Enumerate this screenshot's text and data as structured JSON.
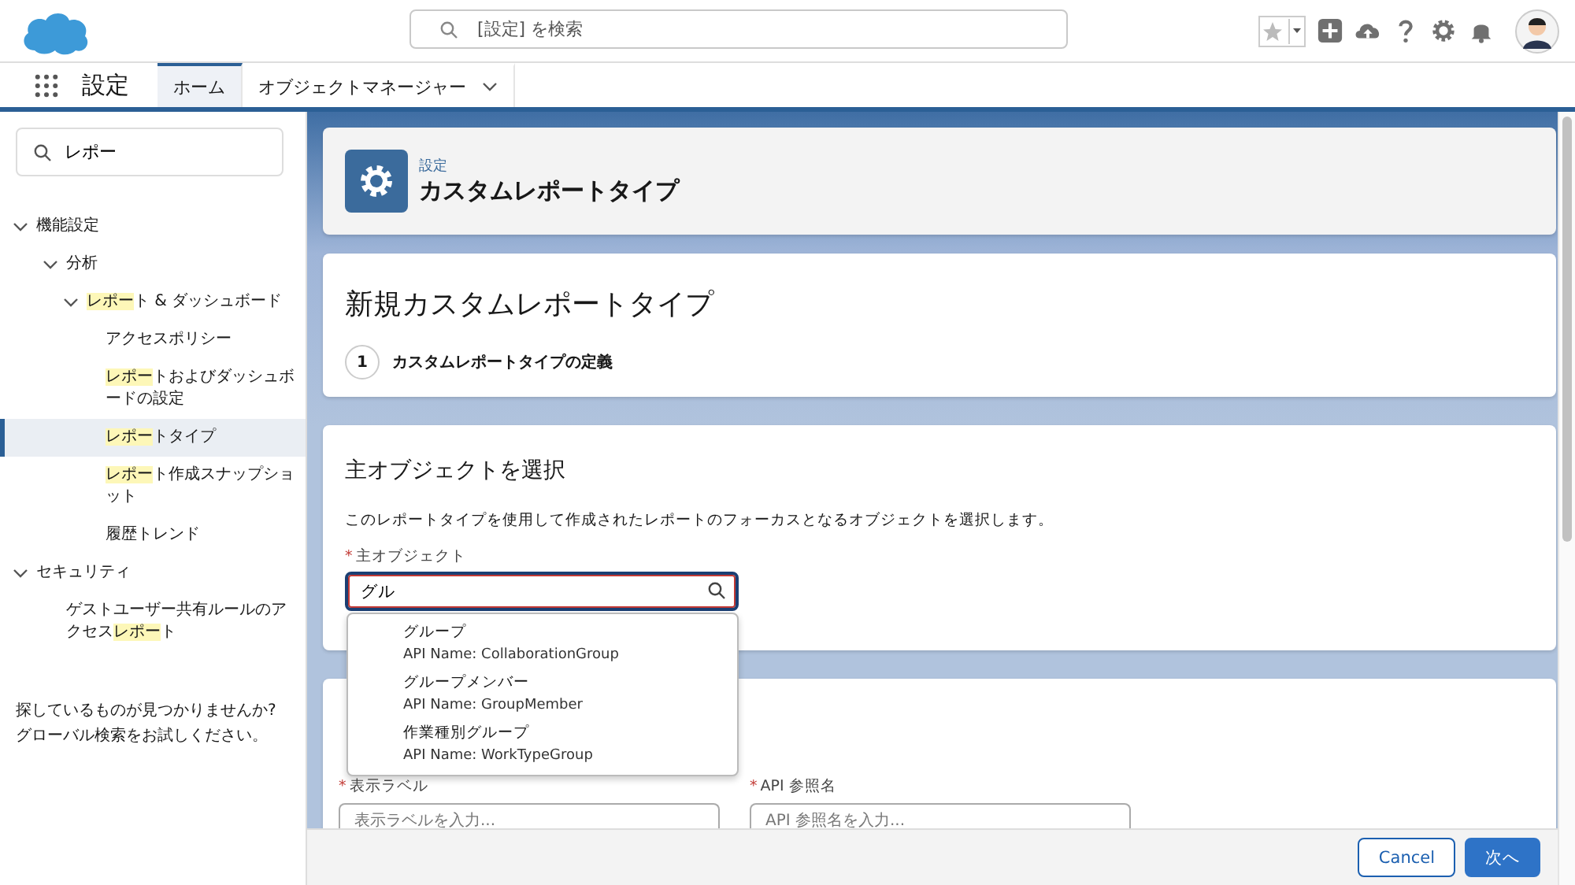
{
  "header": {
    "search_placeholder": "[設定] を検索"
  },
  "nav": {
    "app_name": "設定",
    "tabs": [
      {
        "label": "ホーム",
        "selected": true,
        "has_menu": false
      },
      {
        "label": "オブジェクトマネージャー",
        "selected": false,
        "has_menu": true
      }
    ]
  },
  "sidebar": {
    "search_value": "レポー",
    "tree": [
      {
        "parts": [
          {
            "text": "機能設定",
            "highlight": false
          }
        ],
        "selected": false,
        "expanded": true,
        "children": [
          {
            "parts": [
              {
                "text": "分析",
                "highlight": false
              }
            ],
            "selected": false,
            "expanded": true,
            "children": [
              {
                "parts": [
                  {
                    "text": "レポー",
                    "highlight": true
                  },
                  {
                    "text": "ト & ダッシュボード",
                    "highlight": false
                  }
                ],
                "selected": false,
                "expanded": true,
                "children": [
                  {
                    "parts": [
                      {
                        "text": "アクセスポリシー",
                        "highlight": false
                      }
                    ],
                    "selected": false
                  },
                  {
                    "parts": [
                      {
                        "text": "レポー",
                        "highlight": true
                      },
                      {
                        "text": "トおよびダッシュボードの設定",
                        "highlight": false
                      }
                    ],
                    "selected": false
                  },
                  {
                    "parts": [
                      {
                        "text": "レポー",
                        "highlight": true
                      },
                      {
                        "text": "トタイプ",
                        "highlight": false
                      }
                    ],
                    "selected": true
                  },
                  {
                    "parts": [
                      {
                        "text": "レポー",
                        "highlight": true
                      },
                      {
                        "text": "ト作成スナップショット",
                        "highlight": false
                      }
                    ],
                    "selected": false
                  },
                  {
                    "parts": [
                      {
                        "text": "履歴トレンド",
                        "highlight": false
                      }
                    ],
                    "selected": false
                  }
                ]
              }
            ]
          }
        ]
      },
      {
        "parts": [
          {
            "text": "セキュリティ",
            "highlight": false
          }
        ],
        "selected": false,
        "expanded": true,
        "children": [
          {
            "parts": [
              {
                "text": "ゲストユーザー共有ルールのアクセス",
                "highlight": false
              },
              {
                "text": "レポー",
                "highlight": true
              },
              {
                "text": "ト",
                "highlight": false
              }
            ],
            "selected": false
          }
        ]
      }
    ],
    "help": "探しているものが見つかりませんか? グローバル検索をお試しください。"
  },
  "page_header": {
    "breadcrumb": "設定",
    "title": "カスタムレポートタイプ"
  },
  "wizard": {
    "title": "新規カスタムレポートタイプ",
    "steps": [
      {
        "number": "1",
        "label": "カスタムレポートタイプの定義"
      }
    ]
  },
  "primary_object": {
    "heading": "主オブジェクトを選択",
    "description": "このレポートタイプを使用して作成されたレポートのフォーカスとなるオブジェクトを選択します。",
    "label": "主オブジェクト",
    "value": "グル",
    "required_mark": "*",
    "options": [
      {
        "name": "グループ",
        "api": "API Name: CollaborationGroup"
      },
      {
        "name": "グループメンバー",
        "api": "API Name: GroupMember"
      },
      {
        "name": "作業種別グループ",
        "api": "API Name: WorkTypeGroup"
      }
    ]
  },
  "details": {
    "fields": [
      {
        "required_mark": "*",
        "label": "表示ラベル",
        "placeholder": "表示ラベルを入力..."
      },
      {
        "required_mark": "*",
        "label": "API 参照名",
        "placeholder": "API 参照名を入力..."
      }
    ]
  },
  "footer": {
    "buttons": [
      {
        "label": "Cancel",
        "kind": "neutral"
      },
      {
        "label": "次へ",
        "kind": "brand"
      }
    ]
  }
}
